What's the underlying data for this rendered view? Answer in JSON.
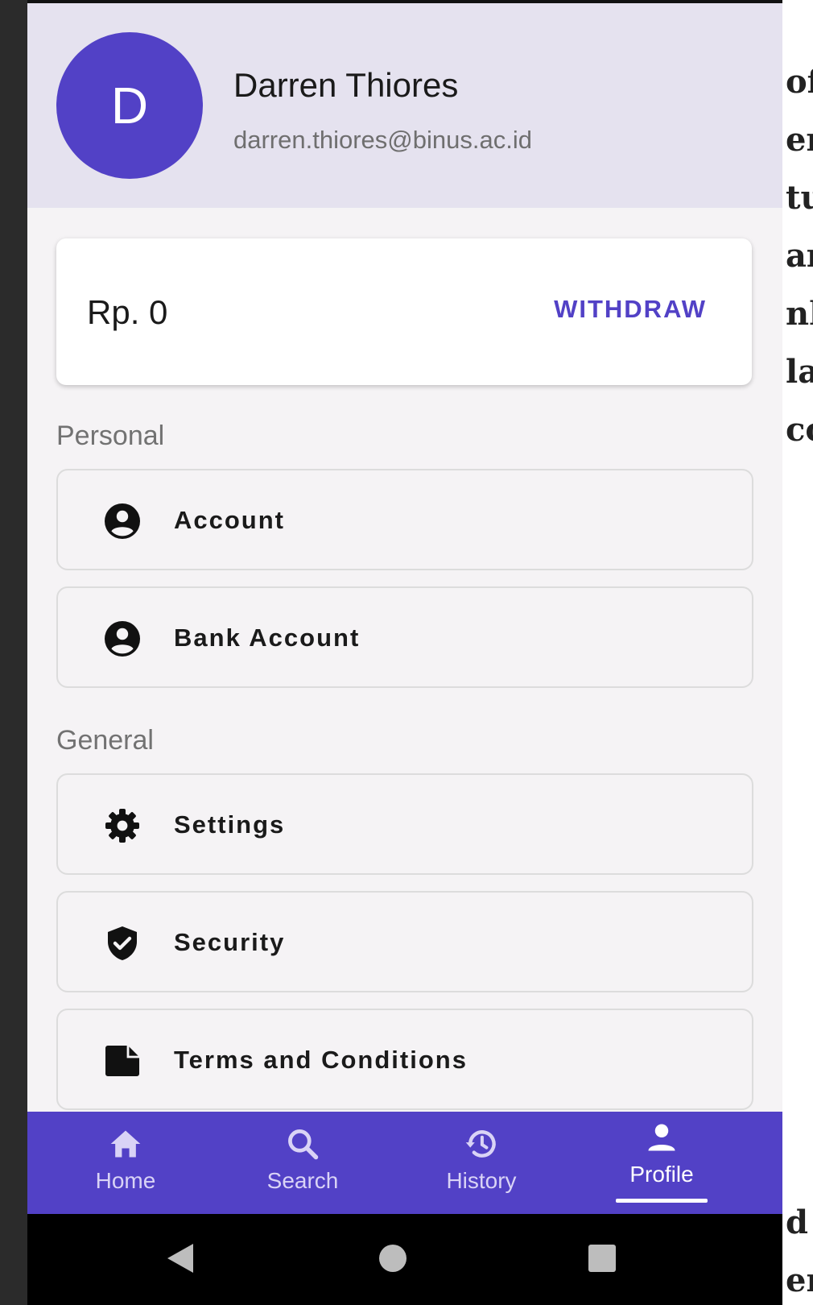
{
  "profile": {
    "avatar_initial": "D",
    "name": "Darren Thiores",
    "email": "darren.thiores@binus.ac.id"
  },
  "balance": {
    "amount": "Rp. 0",
    "withdraw_label": "WITHDRAW"
  },
  "sections": {
    "personal": {
      "title": "Personal",
      "items": [
        {
          "label": "Account",
          "icon": "account-circle-icon"
        },
        {
          "label": "Bank Account",
          "icon": "account-circle-icon"
        }
      ]
    },
    "general": {
      "title": "General",
      "items": [
        {
          "label": "Settings",
          "icon": "gear-icon"
        },
        {
          "label": "Security",
          "icon": "shield-check-icon"
        },
        {
          "label": "Terms and Conditions",
          "icon": "document-icon"
        }
      ]
    }
  },
  "bottom_nav": {
    "items": [
      {
        "label": "Home",
        "icon": "home-icon"
      },
      {
        "label": "Search",
        "icon": "search-icon"
      },
      {
        "label": "History",
        "icon": "history-icon"
      },
      {
        "label": "Profile",
        "icon": "person-icon",
        "active": true
      }
    ]
  },
  "colors": {
    "accent": "#5241c6",
    "header_bg": "#e5e2ef",
    "page_bg": "#f5f3f5"
  },
  "side_fragments": [
    "of",
    "er",
    "tu",
    "ar",
    "nl",
    "la",
    "co",
    "d",
    "en"
  ]
}
